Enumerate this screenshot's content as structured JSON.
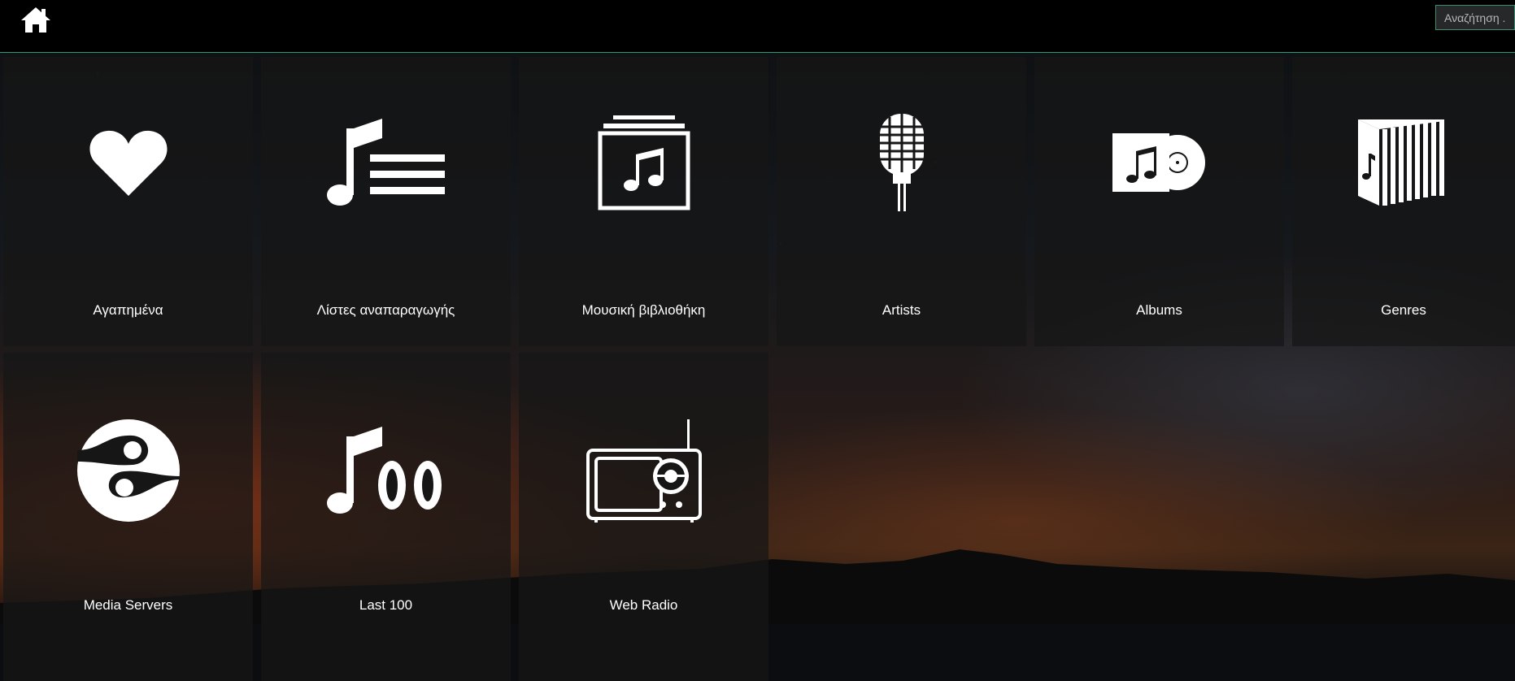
{
  "header": {
    "search_placeholder": "Αναζήτηση ...",
    "home_icon": "home-icon"
  },
  "tiles": [
    {
      "label": "Αγαπημένα",
      "icon": "heart-icon"
    },
    {
      "label": "Λίστες αναπαραγωγής",
      "icon": "playlist-icon"
    },
    {
      "label": "Μουσική βιβλιοθήκη",
      "icon": "music-library-icon"
    },
    {
      "label": "Artists",
      "icon": "microphone-icon"
    },
    {
      "label": "Albums",
      "icon": "album-icon"
    },
    {
      "label": "Genres",
      "icon": "genres-icon"
    },
    {
      "label": "Media Servers",
      "icon": "media-server-icon"
    },
    {
      "label": "Last 100",
      "icon": "last-100-icon"
    },
    {
      "label": "Web Radio",
      "icon": "radio-icon"
    }
  ],
  "colors": {
    "accent": "#2e9a78",
    "tile_bg": "#161616",
    "text": "#ffffff"
  }
}
